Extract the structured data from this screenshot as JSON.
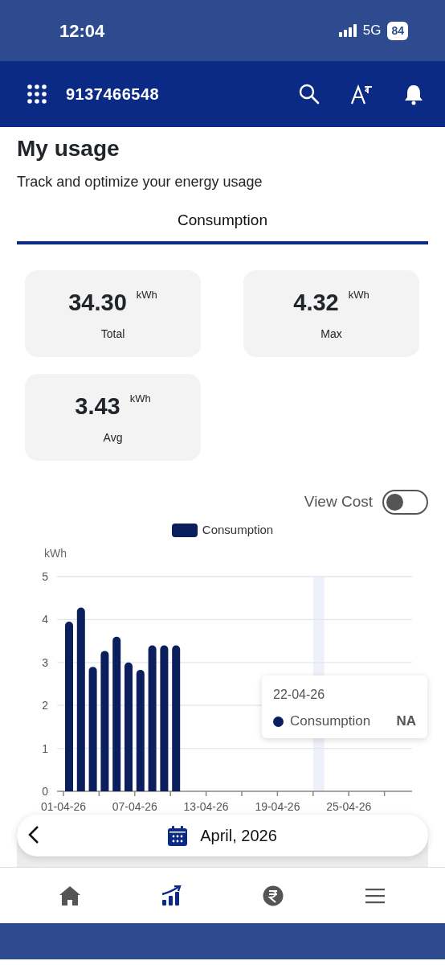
{
  "status_bar": {
    "time": "12:04",
    "network": "5G",
    "battery": "84"
  },
  "header": {
    "account": "9137466548"
  },
  "page": {
    "title": "My usage",
    "subtitle": "Track and optimize your energy usage"
  },
  "tabs": [
    {
      "label": "Consumption",
      "selected": true
    }
  ],
  "stats": [
    {
      "value": "34.30",
      "unit": "kWh",
      "label": "Total"
    },
    {
      "value": "4.32",
      "unit": "kWh",
      "label": "Max"
    },
    {
      "value": "3.43",
      "unit": "kWh",
      "label": "Avg"
    }
  ],
  "view_cost": {
    "label": "View Cost",
    "on": false
  },
  "chart": {
    "chart_data": {
      "type": "bar",
      "ylabel": "kWh",
      "categories": [
        "01-04-26",
        null,
        null,
        null,
        null,
        null,
        "07-04-26",
        null,
        null,
        null,
        null,
        null,
        "13-04-26",
        null,
        null,
        null,
        null,
        null,
        "19-04-26",
        null,
        null,
        null,
        null,
        null,
        "25-04-26",
        null,
        null,
        null,
        null,
        null
      ],
      "grid": true,
      "series": [
        {
          "name": "Consumption",
          "color": "#0a1f5c",
          "values": [
            3.95,
            4.28,
            2.9,
            3.27,
            3.6,
            3.0,
            2.83,
            3.4,
            3.4,
            3.4,
            null,
            null,
            null,
            null,
            null,
            null,
            null,
            null,
            null,
            null,
            null,
            null,
            null,
            null,
            null,
            null,
            null,
            null,
            null,
            null
          ]
        }
      ],
      "yticks": [
        0,
        1,
        2,
        3,
        4,
        5
      ],
      "ylim": [
        0,
        5
      ]
    },
    "tooltip": {
      "date": "22-04-26",
      "series": "Consumption",
      "value": "NA"
    }
  },
  "month_selector": {
    "label": "April, 2026"
  },
  "bottom_nav": [
    {
      "kind": "home",
      "selected": false
    },
    {
      "kind": "usage",
      "selected": true
    },
    {
      "kind": "bill",
      "selected": false
    },
    {
      "kind": "menu",
      "selected": false
    }
  ]
}
